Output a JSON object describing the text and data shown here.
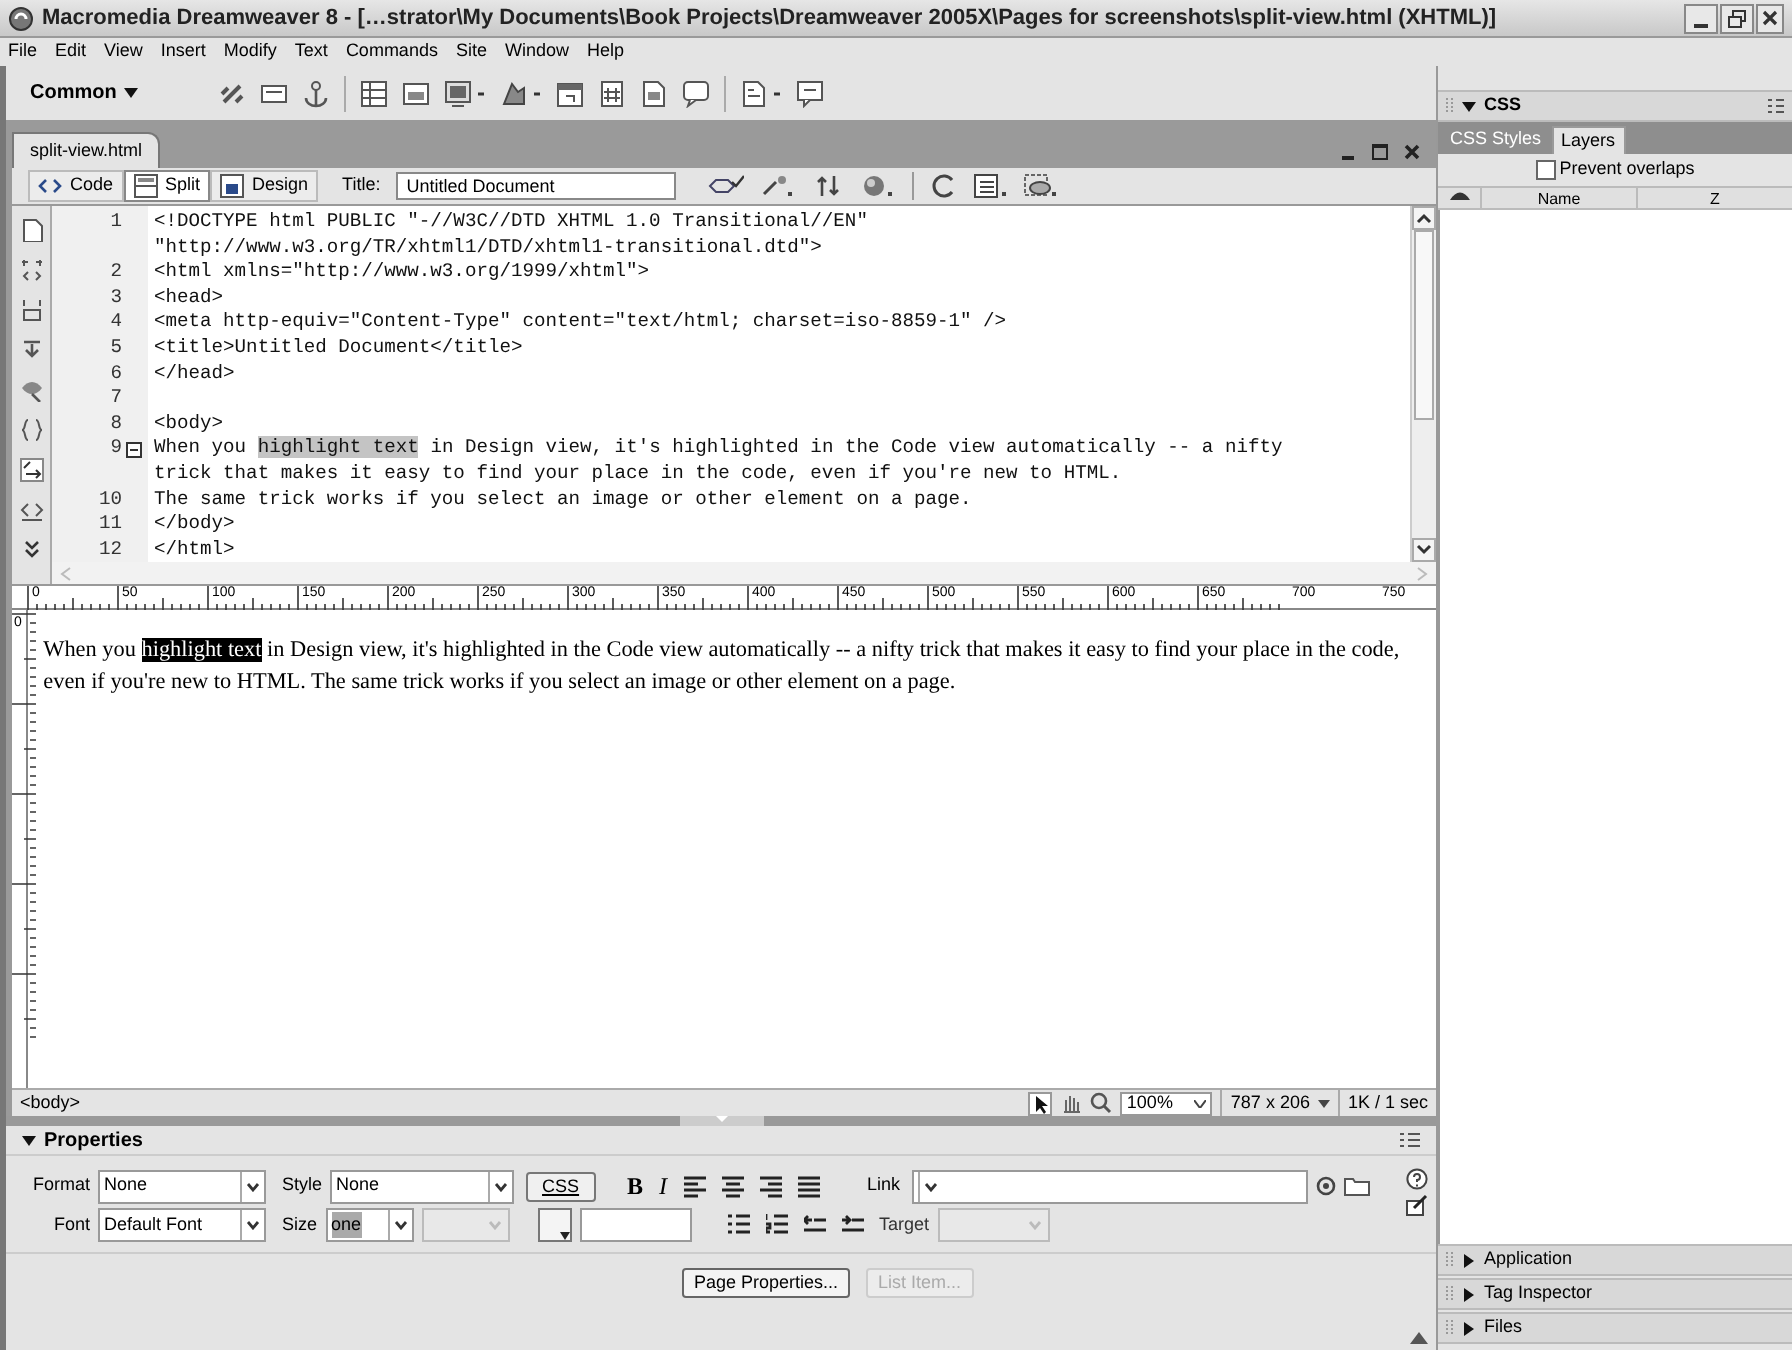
{
  "window": {
    "title": "Macromedia Dreamweaver 8 - […strator\\My Documents\\Book Projects\\Dreamweaver 2005X\\Pages for screenshots\\split-view.html (XHTML)]"
  },
  "menu": [
    "File",
    "Edit",
    "View",
    "Insert",
    "Modify",
    "Text",
    "Commands",
    "Site",
    "Window",
    "Help"
  ],
  "insert_bar": {
    "category": "Common"
  },
  "document": {
    "tab": "split-view.html",
    "view_buttons": [
      {
        "label": "Code",
        "selected": false
      },
      {
        "label": "Split",
        "selected": true
      },
      {
        "label": "Design",
        "selected": false
      }
    ],
    "title_label": "Title:",
    "title_value": "Untitled Document",
    "code_lines": [
      {
        "number": "1",
        "collapsible": false,
        "segments": [
          {
            "text": "<!DOCTYPE html PUBLIC \"-//W3C//DTD XHTML 1.0 Transitional//EN\"",
            "highlighted": false
          }
        ]
      },
      {
        "collapsible": false,
        "segments": [
          {
            "text": "\"http://www.w3.org/TR/xhtml1/DTD/xhtml1-transitional.dtd\">",
            "highlighted": false
          }
        ]
      },
      {
        "number": "2",
        "collapsible": false,
        "segments": [
          {
            "text": "<html xmlns=\"http://www.w3.org/1999/xhtml\">",
            "highlighted": false
          }
        ]
      },
      {
        "number": "3",
        "collapsible": false,
        "segments": [
          {
            "text": "<head>",
            "highlighted": false
          }
        ]
      },
      {
        "number": "4",
        "collapsible": false,
        "segments": [
          {
            "text": "<meta http-equiv=\"Content-Type\" content=\"text/html; charset=iso-8859-1\" />",
            "highlighted": false
          }
        ]
      },
      {
        "number": "5",
        "collapsible": false,
        "segments": [
          {
            "text": "<title>Untitled Document</title>",
            "highlighted": false
          }
        ]
      },
      {
        "number": "6",
        "collapsible": false,
        "segments": [
          {
            "text": "</head>",
            "highlighted": false
          }
        ]
      },
      {
        "number": "7",
        "collapsible": false
      },
      {
        "number": "8",
        "collapsible": false,
        "segments": [
          {
            "text": "<body>",
            "highlighted": false
          }
        ]
      },
      {
        "number": "9",
        "collapsible": true,
        "segments": [
          {
            "text": "When you ",
            "highlighted": false
          },
          {
            "text": "highlight text",
            "highlighted": true
          },
          {
            "text": " in Design view, it's highlighted in the Code view automatically -- a nifty",
            "highlighted": false
          }
        ]
      },
      {
        "collapsible": false,
        "segments": [
          {
            "text": "trick that makes it easy to find your place in the code, even if you're new to HTML.",
            "highlighted": false
          }
        ]
      },
      {
        "number": "10",
        "collapsible": false,
        "segments": [
          {
            "text": "The same trick works if you select an image or other element on a page.",
            "highlighted": false
          }
        ]
      },
      {
        "number": "11",
        "collapsible": false,
        "segments": [
          {
            "text": "</body>",
            "highlighted": false
          }
        ]
      },
      {
        "number": "12",
        "collapsible": false,
        "segments": [
          {
            "text": "</html>",
            "highlighted": false
          }
        ]
      }
    ],
    "ruler_ticks": [
      "0",
      "50",
      "100",
      "150",
      "200",
      "250",
      "300",
      "350",
      "400",
      "450",
      "500",
      "550",
      "600",
      "650",
      "700",
      "750"
    ],
    "vertical_ruler_ticks": [
      "0"
    ],
    "design_text": [
      {
        "text": "When you ",
        "selected": false
      },
      {
        "text": "highlight text",
        "selected": true
      },
      {
        "text": " in Design view, it's highlighted in the Code view automatically -- a nifty trick that makes it easy to find your place in the code, even if you're new to HTML. The same trick works if you select an image or other element on a page.",
        "selected": false
      }
    ],
    "tag_selector": "<body>",
    "zoom": "100%",
    "window_size": "787 x 206",
    "download": "1K / 1 sec"
  },
  "properties": {
    "title": "Properties",
    "expanded": true,
    "format": {
      "label": "Format",
      "value": "None"
    },
    "style": {
      "label": "Style",
      "value": "None"
    },
    "css_button": "CSS",
    "bold": "B",
    "italic": "I",
    "link": {
      "label": "Link"
    },
    "font": {
      "label": "Font",
      "value": "Default Font"
    },
    "size": {
      "label": "Size",
      "value": "one"
    },
    "target": {
      "label": "Target"
    },
    "buttons": [
      {
        "label": "Page Properties...",
        "disabled": false
      },
      {
        "label": "List Item...",
        "disabled": true
      }
    ]
  },
  "side_panels": [
    {
      "title": "CSS",
      "expanded": true,
      "tabs": [
        {
          "label": "CSS Styles",
          "selected": false
        },
        {
          "label": "Layers",
          "selected": true
        }
      ],
      "prevent_overlaps": {
        "label": "Prevent overlaps",
        "checked": false
      },
      "columns": [
        "Name",
        "Z"
      ]
    },
    {
      "title": "Application",
      "expanded": false
    },
    {
      "title": "Tag Inspector",
      "expanded": false
    },
    {
      "title": "Files",
      "expanded": false
    }
  ]
}
